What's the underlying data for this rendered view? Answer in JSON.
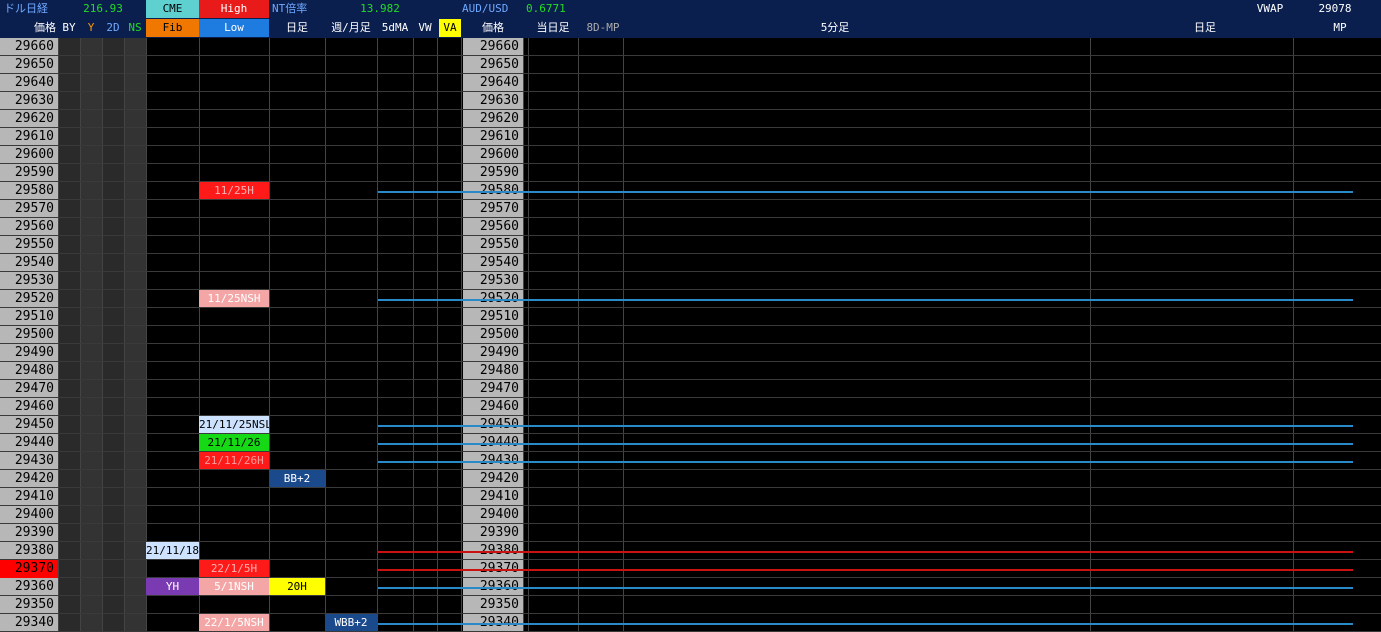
{
  "header": {
    "row1": {
      "dollar_nikkei_label": "ドル日経",
      "dollar_nikkei_value": "216.93",
      "cme": "CME",
      "high": "High",
      "nt_label": "NT倍率",
      "nt_value": "13.982",
      "audusd_label": "AUD/USD",
      "audusd_value": "0.6771",
      "vwap_label": "VWAP",
      "vwap_value": "29078"
    },
    "row2": {
      "price": "価格",
      "by": "BY",
      "y": "Y",
      "d2": "2D",
      "ns": "NS",
      "fib": "Fib",
      "low": "Low",
      "daily": "日足",
      "weekly_monthly": "週/月足",
      "ma5": "5dMA",
      "vw": "VW",
      "va": "VA",
      "price2": "価格",
      "today": "当日足",
      "mp8d": "8D-MP",
      "min5": "5分足",
      "daily2": "日足",
      "mp": "MP"
    }
  },
  "prices": [
    "29660",
    "29650",
    "29640",
    "29630",
    "29620",
    "29610",
    "29600",
    "29590",
    "29580",
    "29570",
    "29560",
    "29550",
    "29540",
    "29530",
    "29520",
    "29510",
    "29500",
    "29490",
    "29480",
    "29470",
    "29460",
    "29450",
    "29440",
    "29430",
    "29420",
    "29410",
    "29400",
    "29390",
    "29380",
    "29370",
    "29360",
    "29350",
    "29340"
  ],
  "current_price": "29370",
  "markers": [
    {
      "text": "11/25H",
      "col": "hl",
      "row": 8,
      "bg": "#ff1a1a",
      "fg": "#ffb0b0"
    },
    {
      "text": "11/25NSH",
      "col": "hl",
      "row": 14,
      "bg": "#f4a6a6",
      "fg": "#ffffff"
    },
    {
      "text": "21/11/25NSL",
      "col": "hl",
      "row": 21,
      "bg": "#cde2ff",
      "fg": "#000000"
    },
    {
      "text": "21/11/26",
      "col": "hl",
      "row": 22,
      "bg": "#16d916",
      "fg": "#000000"
    },
    {
      "text": "21/11/26H",
      "col": "hl",
      "row": 23,
      "bg": "#ff1a1a",
      "fg": "#ff9a9a"
    },
    {
      "text": "BB+2",
      "col": "daily",
      "row": 24,
      "bg": "#1b4a8c",
      "fg": "#ffffff"
    },
    {
      "text": "21/11/18",
      "col": "fib",
      "row": 28,
      "bg": "#cde2ff",
      "fg": "#000000"
    },
    {
      "text": "22/1/5H",
      "col": "hl",
      "row": 29,
      "bg": "#ff1a1a",
      "fg": "#ffb0b0"
    },
    {
      "text": "YH",
      "col": "fib",
      "row": 30,
      "bg": "#7a3ab2",
      "fg": "#ffffff"
    },
    {
      "text": "5/1NSH",
      "col": "hl",
      "row": 30,
      "bg": "#f4a6a6",
      "fg": "#ffffff"
    },
    {
      "text": "20H",
      "col": "daily",
      "row": 30,
      "bg": "#ffff00",
      "fg": "#000000"
    },
    {
      "text": "22/1/5NSH",
      "col": "hl",
      "row": 32,
      "bg": "#f4a6a6",
      "fg": "#ffffff"
    },
    {
      "text": "WBB+2",
      "col": "weekly",
      "row": 32,
      "bg": "#1b4a8c",
      "fg": "#ffffff"
    }
  ],
  "levels": [
    {
      "row": 8,
      "color": "#2a8ac8"
    },
    {
      "row": 14,
      "color": "#2a8ac8"
    },
    {
      "row": 21,
      "color": "#2a8ac8"
    },
    {
      "row": 22,
      "color": "#2a8ac8"
    },
    {
      "row": 23,
      "color": "#2a8ac8"
    },
    {
      "row": 28,
      "color": "#cc1111"
    },
    {
      "row": 29,
      "color": "#cc1111"
    },
    {
      "row": 30,
      "color": "#2a8ac8"
    },
    {
      "row": 32,
      "color": "#2a8ac8"
    }
  ],
  "colors": {
    "header_bg": "#0b1f4f",
    "price_col": "#b7b7b7",
    "current_price_bg": "#ff0000",
    "green_value": "#22dd22",
    "level_blue": "#2a8ac8",
    "level_red": "#cc1111"
  }
}
